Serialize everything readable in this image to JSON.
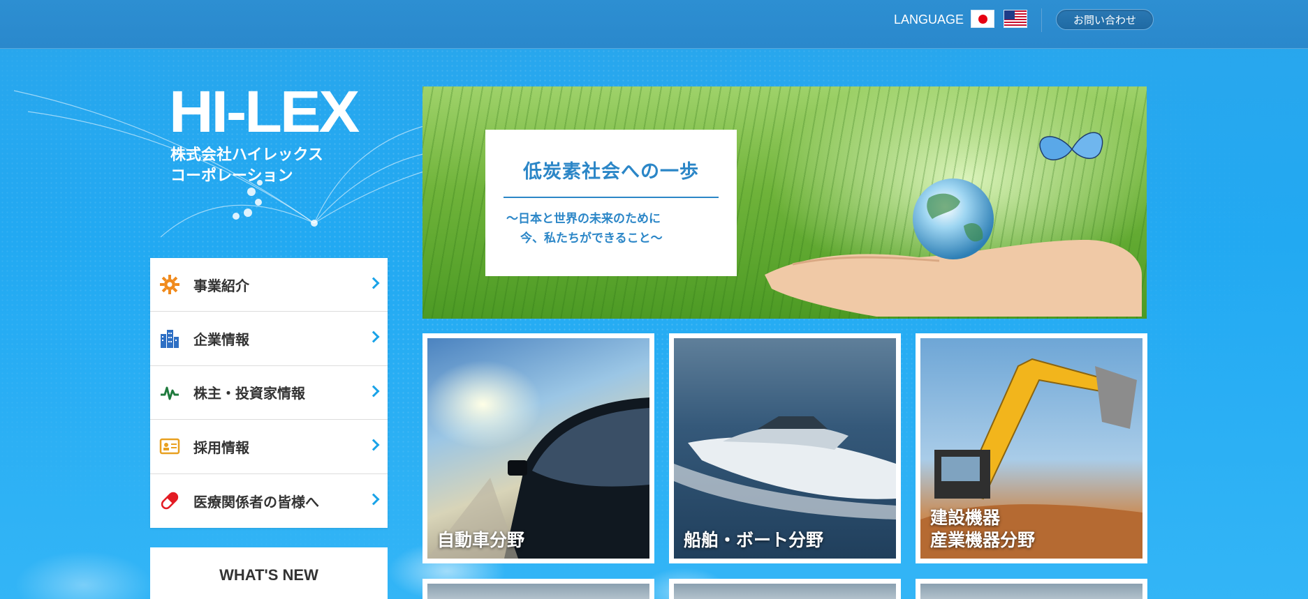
{
  "header": {
    "language_label": "LANGUAGE",
    "languages": [
      {
        "code": "ja",
        "icon": "japan-flag-icon"
      },
      {
        "code": "en",
        "icon": "us-flag-icon"
      }
    ],
    "contact_label": "お問い合わせ"
  },
  "logo": {
    "mark": "HI-LEX",
    "company_line1": "株式会社ハイレックス",
    "company_line2": "コーポレーション"
  },
  "nav": {
    "items": [
      {
        "label": "事業紹介",
        "icon": "gear-icon",
        "color": "#f08a1c"
      },
      {
        "label": "企業情報",
        "icon": "building-icon",
        "color": "#2d6fc4"
      },
      {
        "label": "株主・投資家情報",
        "icon": "stock-chart-icon",
        "color": "#1f7a3d"
      },
      {
        "label": "採用情報",
        "icon": "id-card-icon",
        "color": "#e8a020"
      },
      {
        "label": "医療関係者の皆様へ",
        "icon": "capsule-icon",
        "color": "#e31b23"
      }
    ]
  },
  "whats_new": {
    "title": "WHAT'S NEW"
  },
  "hero": {
    "title": "低炭素社会への一歩",
    "subtitle_line1": "〜日本と世界の未来のために",
    "subtitle_line2": "今、私たちができること〜"
  },
  "tiles": [
    {
      "label_lines": [
        "自動車分野"
      ]
    },
    {
      "label_lines": [
        "船舶・ボート分野"
      ]
    },
    {
      "label_lines": [
        "建設機器",
        "産業機器分野"
      ]
    }
  ],
  "colors": {
    "accent": "#1aa3e8",
    "header_bg": "#2a88cc",
    "hero_text": "#2b86c7"
  }
}
